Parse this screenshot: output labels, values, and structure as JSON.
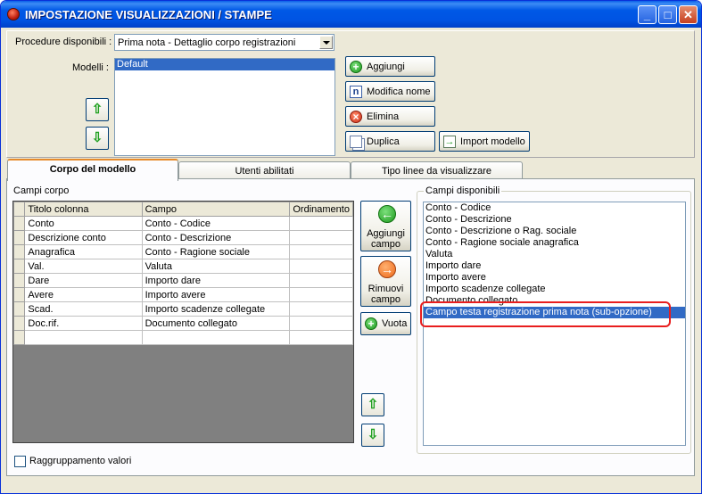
{
  "window": {
    "title": "IMPOSTAZIONE VISUALIZZAZIONI / STAMPE",
    "minimize": "_",
    "maximize": "□",
    "close": "✕"
  },
  "top": {
    "procedures_label": "Procedure disponibili :",
    "procedure_value": "Prima nota - Dettaglio corpo registrazioni",
    "models_label": "Modelli :",
    "models": [
      "Default"
    ],
    "buttons": {
      "add": "Aggiungi",
      "rename": "Modifica nome",
      "delete": "Elimina",
      "duplicate": "Duplica",
      "import": "Import modello"
    }
  },
  "tabs": [
    "Corpo del modello",
    "Utenti abilitati",
    "Tipo linee da visualizzare"
  ],
  "body": {
    "fields_label": "Campi corpo",
    "columns": [
      "Titolo colonna",
      "Campo",
      "Ordinamento"
    ],
    "rows": [
      [
        "Conto",
        "Conto - Codice",
        ""
      ],
      [
        "Descrizione conto",
        "Conto - Descrizione",
        ""
      ],
      [
        "Anagrafica",
        "Conto - Ragione sociale",
        ""
      ],
      [
        "Val.",
        "Valuta",
        ""
      ],
      [
        "Dare",
        "Importo dare",
        ""
      ],
      [
        "Avere",
        "Importo avere",
        ""
      ],
      [
        "Scad.",
        "Importo scadenze collegate",
        ""
      ],
      [
        "Doc.rif.",
        "Documento collegato",
        ""
      ],
      [
        "",
        "",
        ""
      ]
    ],
    "add_field": [
      "Aggiungi",
      "campo"
    ],
    "remove_field": [
      "Rimuovi",
      "campo"
    ],
    "clear": "Vuota",
    "available_label": "Campi disponibili",
    "available": [
      "Conto - Codice",
      "Conto - Descrizione",
      "Conto - Descrizione o Rag. sociale",
      "Conto - Ragione sociale anagrafica",
      "Valuta",
      "Importo dare",
      "Importo avere",
      "Importo scadenze collegate",
      "Documento collegato",
      "Campo testa registrazione prima nota (sub-opzione)"
    ],
    "available_selected_index": 9,
    "grouping_label": "Raggruppamento valori"
  }
}
